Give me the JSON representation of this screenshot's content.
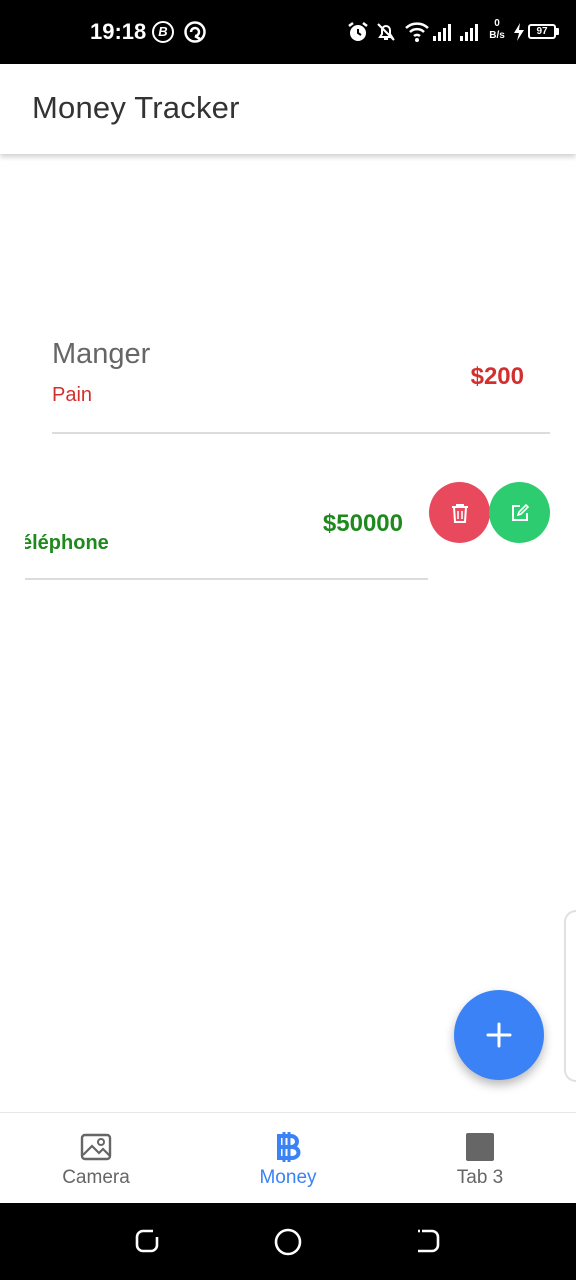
{
  "status_bar": {
    "time": "19:18",
    "badge_1": "B",
    "net_speed_value": "0",
    "net_speed_unit": "B/s",
    "battery": "97"
  },
  "app_bar": {
    "title": "Money Tracker"
  },
  "entries": [
    {
      "title": "Manger",
      "category": "Pain",
      "amount": "$200",
      "color": "#d32f2f"
    },
    {
      "title": "",
      "category": "éléphone",
      "amount": "$50000",
      "color": "#1e8a1e"
    }
  ],
  "actions": {
    "delete_icon": "trash-icon",
    "edit_icon": "edit-icon",
    "delete_color": "#e8495c",
    "edit_color": "#2ecc71"
  },
  "fab": {
    "icon": "plus-icon",
    "color": "#3b82f6"
  },
  "bottom_nav": {
    "items": [
      {
        "label": "Camera",
        "icon": "image-icon",
        "active": false
      },
      {
        "label": "Money",
        "icon": "bitcoin-icon",
        "active": true
      },
      {
        "label": "Tab 3",
        "icon": "square-icon",
        "active": false
      }
    ],
    "active_color": "#3b82f6"
  }
}
